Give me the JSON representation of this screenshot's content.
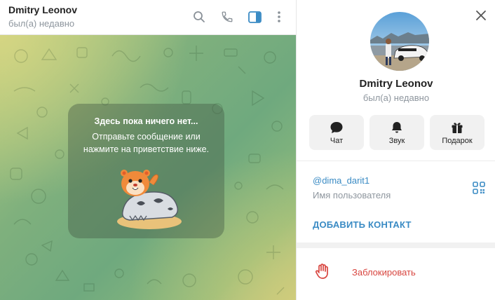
{
  "chat": {
    "title": "Dmitry Leonov",
    "status": "был(а) недавно",
    "empty": {
      "title": "Здесь пока ничего нет...",
      "text": "Отправьте сообщение или нажмите на приветствие ниже."
    }
  },
  "header_icons": [
    "search-icon",
    "phone-icon",
    "sidebar-toggle-icon",
    "more-vertical-icon"
  ],
  "profile": {
    "name": "Dmitry Leonov",
    "status": "был(а) недавно",
    "actions": [
      {
        "label": "Чат",
        "icon": "chat-icon"
      },
      {
        "label": "Звук",
        "icon": "bell-icon"
      },
      {
        "label": "Подарок",
        "icon": "gift-icon"
      }
    ],
    "username": "@dima_darit1",
    "username_label": "Имя пользователя",
    "add_contact": "ДОБАВИТЬ КОНТАКТ",
    "block": "Заблокировать"
  },
  "colors": {
    "accent": "#3a8bc4",
    "danger": "#d8453f",
    "muted": "#8e969e"
  }
}
